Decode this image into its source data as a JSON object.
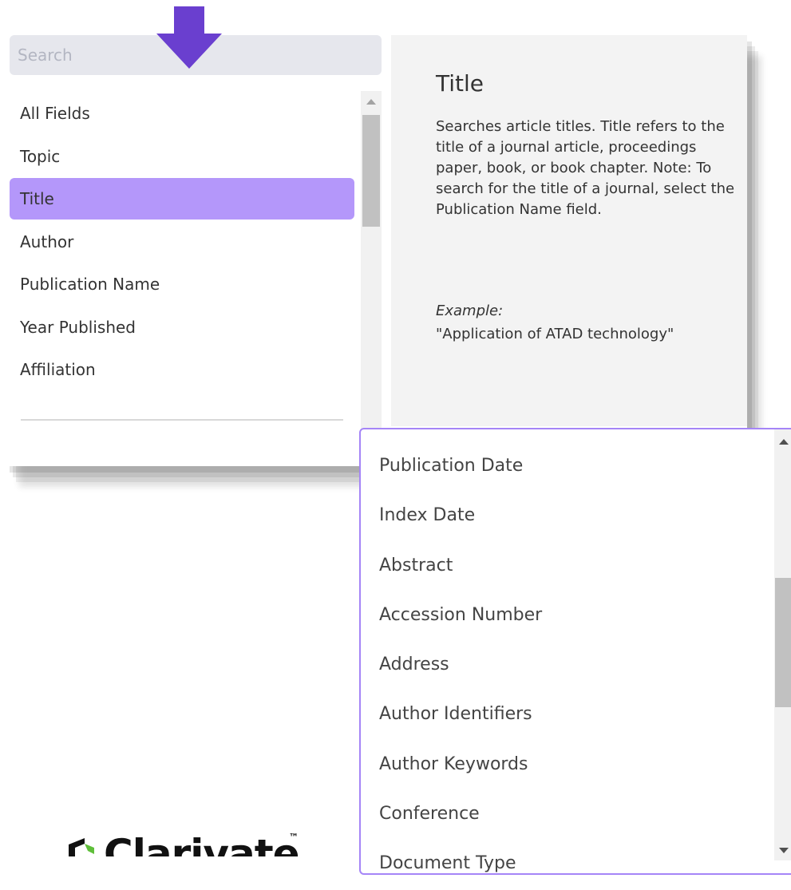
{
  "search": {
    "placeholder": "Search"
  },
  "fields": {
    "items": [
      {
        "label": "All Fields",
        "selected": false
      },
      {
        "label": "Topic",
        "selected": false
      },
      {
        "label": "Title",
        "selected": true
      },
      {
        "label": "Author",
        "selected": false
      },
      {
        "label": "Publication Name",
        "selected": false
      },
      {
        "label": "Year Published",
        "selected": false
      },
      {
        "label": "Affiliation",
        "selected": false
      }
    ]
  },
  "description": {
    "title": "Title",
    "text": "Searches article titles. Title refers to the title of a journal article, proceedings paper, book, or book chapter. Note: To search for the title of a journal, select the Publication Name field.",
    "example_label": "Example:",
    "example": "\"Application of ATAD technology\""
  },
  "dropdown": {
    "items": [
      "Publication Date",
      "Index Date",
      "Abstract",
      "Accession Number",
      "Address",
      "Author Identifiers",
      "Author Keywords",
      "Conference",
      "Document Type"
    ]
  },
  "logo": {
    "text": "Clarivate",
    "trademark": "™"
  },
  "colors": {
    "accent": "#8a5cf6",
    "selected_bg": "#b497fa",
    "arrow": "#6a3fcf",
    "dropdown_border": "#a585f7",
    "logo_green": "#5fbf3a"
  },
  "icons": {
    "pointer": "down-arrow-icon",
    "scroll_up": "chevron-up-icon",
    "scroll_down": "chevron-down-icon"
  }
}
